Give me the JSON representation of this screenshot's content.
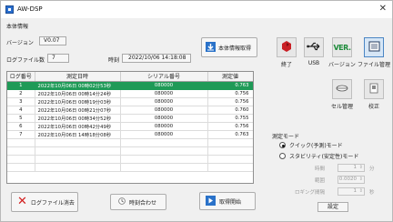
{
  "window": {
    "title": "AW-DSP",
    "close_glyph": "✕"
  },
  "info": {
    "section_title": "本体情報",
    "version_label": "バージョン",
    "version_value": "V0.07",
    "logcount_label": "ログファイル数",
    "logcount_value": "7",
    "time_label": "時刻",
    "time_value": "2022/10/06 14:18:08",
    "fetch_button": "本体情報取得"
  },
  "table": {
    "headers": [
      "ログ番号",
      "測定日時",
      "シリアル番号",
      "測定値"
    ],
    "rows": [
      [
        "1",
        "2022年10月06日 00時02分53秒",
        "080000",
        "0.763"
      ],
      [
        "2",
        "2022年10月06日 00時14分24秒",
        "080000",
        "0.756"
      ],
      [
        "3",
        "2022年10月06日 00時19分03秒",
        "080000",
        "0.756"
      ],
      [
        "4",
        "2022年10月06日 00時21分07秒",
        "080000",
        "0.760"
      ],
      [
        "5",
        "2022年10月06日 00時34分52秒",
        "080000",
        "0.755"
      ],
      [
        "6",
        "2022年10月06日 00時42分49秒",
        "080000",
        "0.756"
      ],
      [
        "7",
        "2022年10月06日 14時18分08秒",
        "080000",
        "0.763"
      ]
    ],
    "selected_index": 0
  },
  "bottom_buttons": {
    "clear_logs": "ログファイル消去",
    "sync_time": "時刻合わせ",
    "start_fetch": "取得開始"
  },
  "side": {
    "exit": "終了",
    "usb": "USB",
    "version": "バージョン",
    "file_manage": "ファイル管理",
    "cell_manage": "セル管理",
    "calibrate": "校正"
  },
  "measure": {
    "title": "測定モード",
    "quick_mode": "クイック(予測)モード",
    "stable_mode": "スタビリティ(安定性)モード",
    "time_label": "時間",
    "time_value": "1",
    "time_unit": "分",
    "range_label": "範囲",
    "range_value": "0.0020",
    "log_interval_label": "ロギング間隔",
    "log_interval_value": "1",
    "log_interval_unit": "秒",
    "set_button": "設定"
  },
  "colors": {
    "selected_row": "#1f9a57",
    "active_tool": "#d6e6f6"
  }
}
